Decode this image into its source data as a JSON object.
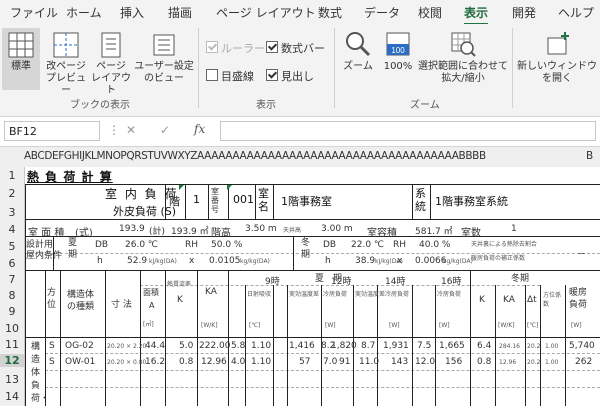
{
  "ribbon_tabs": [
    {
      "label": "ファイル",
      "active": false
    },
    {
      "label": "ホーム",
      "active": false
    },
    {
      "label": "挿入",
      "active": false
    },
    {
      "label": "描画",
      "active": false
    },
    {
      "label": "ページ レイアウト",
      "active": false
    },
    {
      "label": "数式",
      "active": false
    },
    {
      "label": "データ",
      "active": false
    },
    {
      "label": "校閲",
      "active": false
    },
    {
      "label": "表示",
      "active": true
    },
    {
      "label": "開発",
      "active": false
    },
    {
      "label": "ヘルプ",
      "active": false
    }
  ],
  "ribbon": {
    "book_view": {
      "normal": "標準",
      "page_break_1": "改ページ",
      "page_break_2": "プレビュー",
      "page_layout_1": "ページ",
      "page_layout_2": "レイアウト",
      "custom_1": "ユーザー設定",
      "custom_2": "のビュー",
      "group": "ブックの表示"
    },
    "show": {
      "ruler": "ルーラー",
      "ruler_checked": true,
      "ruler_disabled": true,
      "formula_bar": "数式バー",
      "formula_bar_checked": true,
      "gridlines": "目盛線",
      "gridlines_checked": false,
      "headings": "見出し",
      "headings_checked": true,
      "group": "表示"
    },
    "zoom": {
      "zoom": "ズーム",
      "hundred": "100%",
      "hundred_icon_text": "100",
      "fit_1": "選択範囲に合わせて",
      "fit_2": "拡大/縮小",
      "group": "ズーム"
    },
    "window": {
      "new_1": "新しいウィンドウ",
      "new_2": "を開く"
    }
  },
  "formula_bar": {
    "name_box": "BF12",
    "cancel": "✕",
    "confirm": "✓",
    "fx": "fx",
    "content": ""
  },
  "sheet": {
    "column_letters": "ABCDEFGHIJKLMNOPQRSTUVWXYZAAAAAAAAAAAAAAAAAAAAAAAAAAAAAAAAAAAAABBBB",
    "column_letters_2": "B",
    "rows": [
      "1",
      "2",
      "3",
      "4",
      "5",
      "6",
      "7",
      "8",
      "9",
      "10",
      "11",
      "12",
      "13",
      "14"
    ],
    "selected_row": "12",
    "cells": {
      "title": "熱 負 荷 計 算",
      "shitsunai": "室 内 負 荷",
      "gaihi": "外皮負荷 (S)",
      "kai_label": "階",
      "kai_val": "1",
      "shitsu_bango": "室番号",
      "room_no": "001",
      "shitsu_mei": "室名",
      "room_name": "1階事務室",
      "keitou": "系統",
      "system_name": "1階事務室系統",
      "menseki": "室 面 積",
      "shiki": "(式)",
      "area_m2": "193.9",
      "kei": "(計)",
      "area_total": "193.9 ㎡",
      "kaidaka": "階高",
      "kaidaka_val": "3.50 m",
      "tenjou": "天井高",
      "tenjou_val": "3.00 m",
      "volume_label": "室容積",
      "volume_val": "581.7 ㎥",
      "shitsu_su": "室数",
      "shitsu_su_val": "1",
      "sekkei_1": "設計用",
      "sekkei_2": "屋内条件",
      "kaki": "夏期",
      "db": "DB",
      "s_db": "26.0 ℃",
      "rh": "RH",
      "s_rh": "50.0 %",
      "h": "h",
      "s_h": "52.9",
      "x": "x",
      "s_x": "0.0105",
      "unit_h": "kJ/kg(DA)",
      "unit_x": "kg/kg(DA)",
      "touki": "冬期",
      "w_db": "22.0 ℃",
      "w_rh": "40.0 %",
      "w_h": "38.9",
      "w_x": "0.0066",
      "note1": "天井裏による熱除去割合",
      "note2": "暖房負荷の補正係数",
      "dash": "－",
      "kaki_hdr": "夏　期",
      "touki_hdr": "冬期",
      "houi": "方位",
      "kouzou": "構造体の種類",
      "sunpou": "寸 法",
      "menseki_a": "面積",
      "a": "A",
      "a_unit": "[㎡]",
      "netsu_k": "熱貫流率",
      "k": "K",
      "ka": "KA",
      "ka_unit": "[W/K]",
      "t9": "9時",
      "t12": "12時",
      "t14": "14時",
      "t16": "16時",
      "shadow": "日射吸収",
      "shadow_sub": "[℃]",
      "etd": "実効温度差",
      "load": "冷房負荷",
      "load_unit": "[W]",
      "w_k": "K",
      "w_ka": "KA",
      "dt": "Δt",
      "dt_unit": "[℃]",
      "houi_keisu": "方位係数",
      "danbou": "暖房負荷",
      "danbou_unit": "[W]",
      "kouzoutai": "構造体負荷・外",
      "r11": [
        "S",
        "OG-02",
        "20.20 × 2.20",
        "44.4",
        "5.0",
        "222.00",
        "5.8",
        "1.10",
        "1,416",
        "8.2",
        "1,820",
        "8.7",
        "1,931",
        "7.5",
        "1,665",
        "6.4",
        "284.16",
        "20.2",
        "1.00",
        "5,740"
      ],
      "r12": [
        "S",
        "OW-01",
        "20.20 × 0.80",
        "16.2",
        "0.8",
        "12.96",
        "4.0",
        "1.10",
        "57",
        "7.0",
        "91",
        "11.0",
        "143",
        "12.0",
        "156",
        "0.8",
        "12.96",
        "20.2",
        "1.00",
        "262"
      ]
    }
  }
}
